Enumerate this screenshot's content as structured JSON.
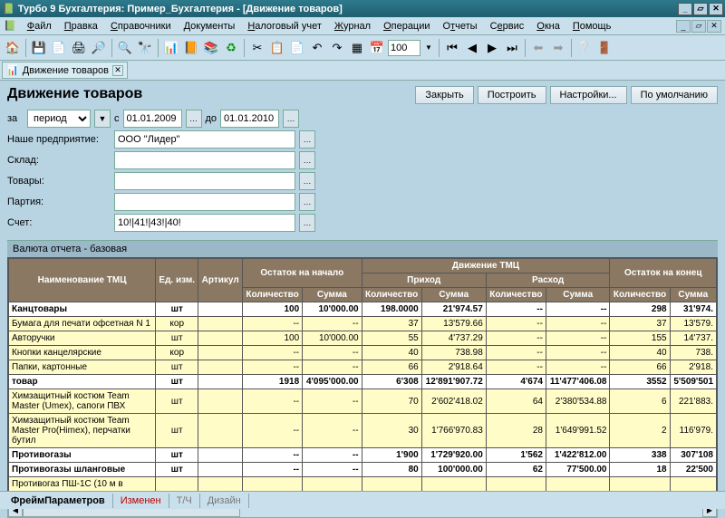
{
  "title": "Турбо 9 Бухгалтерия: Пример_Бухгалтерия - [Движение товаров]",
  "menu": [
    "Файл",
    "Правка",
    "Справочники",
    "Документы",
    "Налоговый учет",
    "Журнал",
    "Операции",
    "Отчеты",
    "Сервис",
    "Окна",
    "Помощь"
  ],
  "toolbar_zoom": "100",
  "tab": "Движение товаров",
  "heading": "Движение товаров",
  "buttons": {
    "close": "Закрыть",
    "build": "Построить",
    "settings": "Настройки...",
    "default": "По умолчанию"
  },
  "filters": {
    "za": "за",
    "period": "период",
    "s": "с",
    "date_from": "01.01.2009",
    "do": "до",
    "date_to": "01.01.2010",
    "l_company": "Наше предприятие:",
    "company": "ООО \"Лидер\"",
    "l_sklad": "Склад:",
    "sklad": "",
    "l_tovary": "Товары:",
    "tovary": "",
    "l_partia": "Партия:",
    "partia": "",
    "l_schet": "Счет:",
    "schet": "10!|41!|43!|40!"
  },
  "report_sub": "Валюта отчета - базовая",
  "headers": {
    "name": "Наименование ТМЦ",
    "ed": "Ед. изм.",
    "art": "Артикул",
    "start": "Остаток на начало",
    "move": "Движение ТМЦ",
    "end": "Остаток на конец",
    "prihod": "Приход",
    "rashod": "Расход",
    "qty": "Количество",
    "sum": "Сумма"
  },
  "rows": [
    {
      "grp": true,
      "name": "Канцтовары",
      "ed": "шт",
      "art": "",
      "sq": "100",
      "ss": "10'000.00",
      "pq": "198.0000",
      "ps": "21'974.57",
      "rq": "--",
      "rs": "--",
      "eq": "298",
      "es": "31'974."
    },
    {
      "grp": false,
      "name": "Бумага для печати офсетная N 1",
      "ed": "кор",
      "art": "",
      "sq": "--",
      "ss": "--",
      "pq": "37",
      "ps": "13'579.66",
      "rq": "--",
      "rs": "--",
      "eq": "37",
      "es": "13'579."
    },
    {
      "grp": false,
      "name": "Авторучки",
      "ed": "шт",
      "art": "",
      "sq": "100",
      "ss": "10'000.00",
      "pq": "55",
      "ps": "4'737.29",
      "rq": "--",
      "rs": "--",
      "eq": "155",
      "es": "14'737."
    },
    {
      "grp": false,
      "name": "Кнопки канцелярские",
      "ed": "кор",
      "art": "",
      "sq": "--",
      "ss": "--",
      "pq": "40",
      "ps": "738.98",
      "rq": "--",
      "rs": "--",
      "eq": "40",
      "es": "738."
    },
    {
      "grp": false,
      "name": "Папки, картонные",
      "ed": "шт",
      "art": "",
      "sq": "--",
      "ss": "--",
      "pq": "66",
      "ps": "2'918.64",
      "rq": "--",
      "rs": "--",
      "eq": "66",
      "es": "2'918."
    },
    {
      "grp": true,
      "name": "товар",
      "ed": "шт",
      "art": "",
      "sq": "1918",
      "ss": "4'095'000.00",
      "pq": "6'308",
      "ps": "12'891'907.72",
      "rq": "4'674",
      "rs": "11'477'406.08",
      "eq": "3552",
      "es": "5'509'501"
    },
    {
      "grp": false,
      "name": "Химзащитный костюм Team Master (Umex), сапоги ПВХ",
      "ed": "шт",
      "art": "",
      "sq": "--",
      "ss": "--",
      "pq": "70",
      "ps": "2'602'418.02",
      "rq": "64",
      "rs": "2'380'534.88",
      "eq": "6",
      "es": "221'883."
    },
    {
      "grp": false,
      "name": "Химзащитный костюм Team Master Pro(Himex), перчатки бутил",
      "ed": "шт",
      "art": "",
      "sq": "--",
      "ss": "--",
      "pq": "30",
      "ps": "1'766'970.83",
      "rq": "28",
      "rs": "1'649'991.52",
      "eq": "2",
      "es": "116'979."
    },
    {
      "grp": true,
      "name": "Противогазы",
      "ed": "шт",
      "art": "",
      "sq": "--",
      "ss": "--",
      "pq": "1'900",
      "ps": "1'729'920.00",
      "rq": "1'562",
      "rs": "1'422'812.00",
      "eq": "338",
      "es": "307'108"
    },
    {
      "grp": true,
      "name": "Противогазы шланговые",
      "ed": "шт",
      "art": "",
      "sq": "--",
      "ss": "--",
      "pq": "80",
      "ps": "100'000.00",
      "rq": "62",
      "rs": "77'500.00",
      "eq": "18",
      "es": "22'500"
    },
    {
      "grp": false,
      "name": "Противогаз ПШ-1С (10 м в",
      "ed": "",
      "art": "",
      "sq": "",
      "ss": "",
      "pq": "",
      "ps": "",
      "rq": "",
      "rs": "",
      "eq": "",
      "es": ""
    }
  ],
  "status": {
    "frame": "ФреймПараметров",
    "changed": "Изменен",
    "tch": "Т/Ч",
    "design": "Дизайн"
  }
}
